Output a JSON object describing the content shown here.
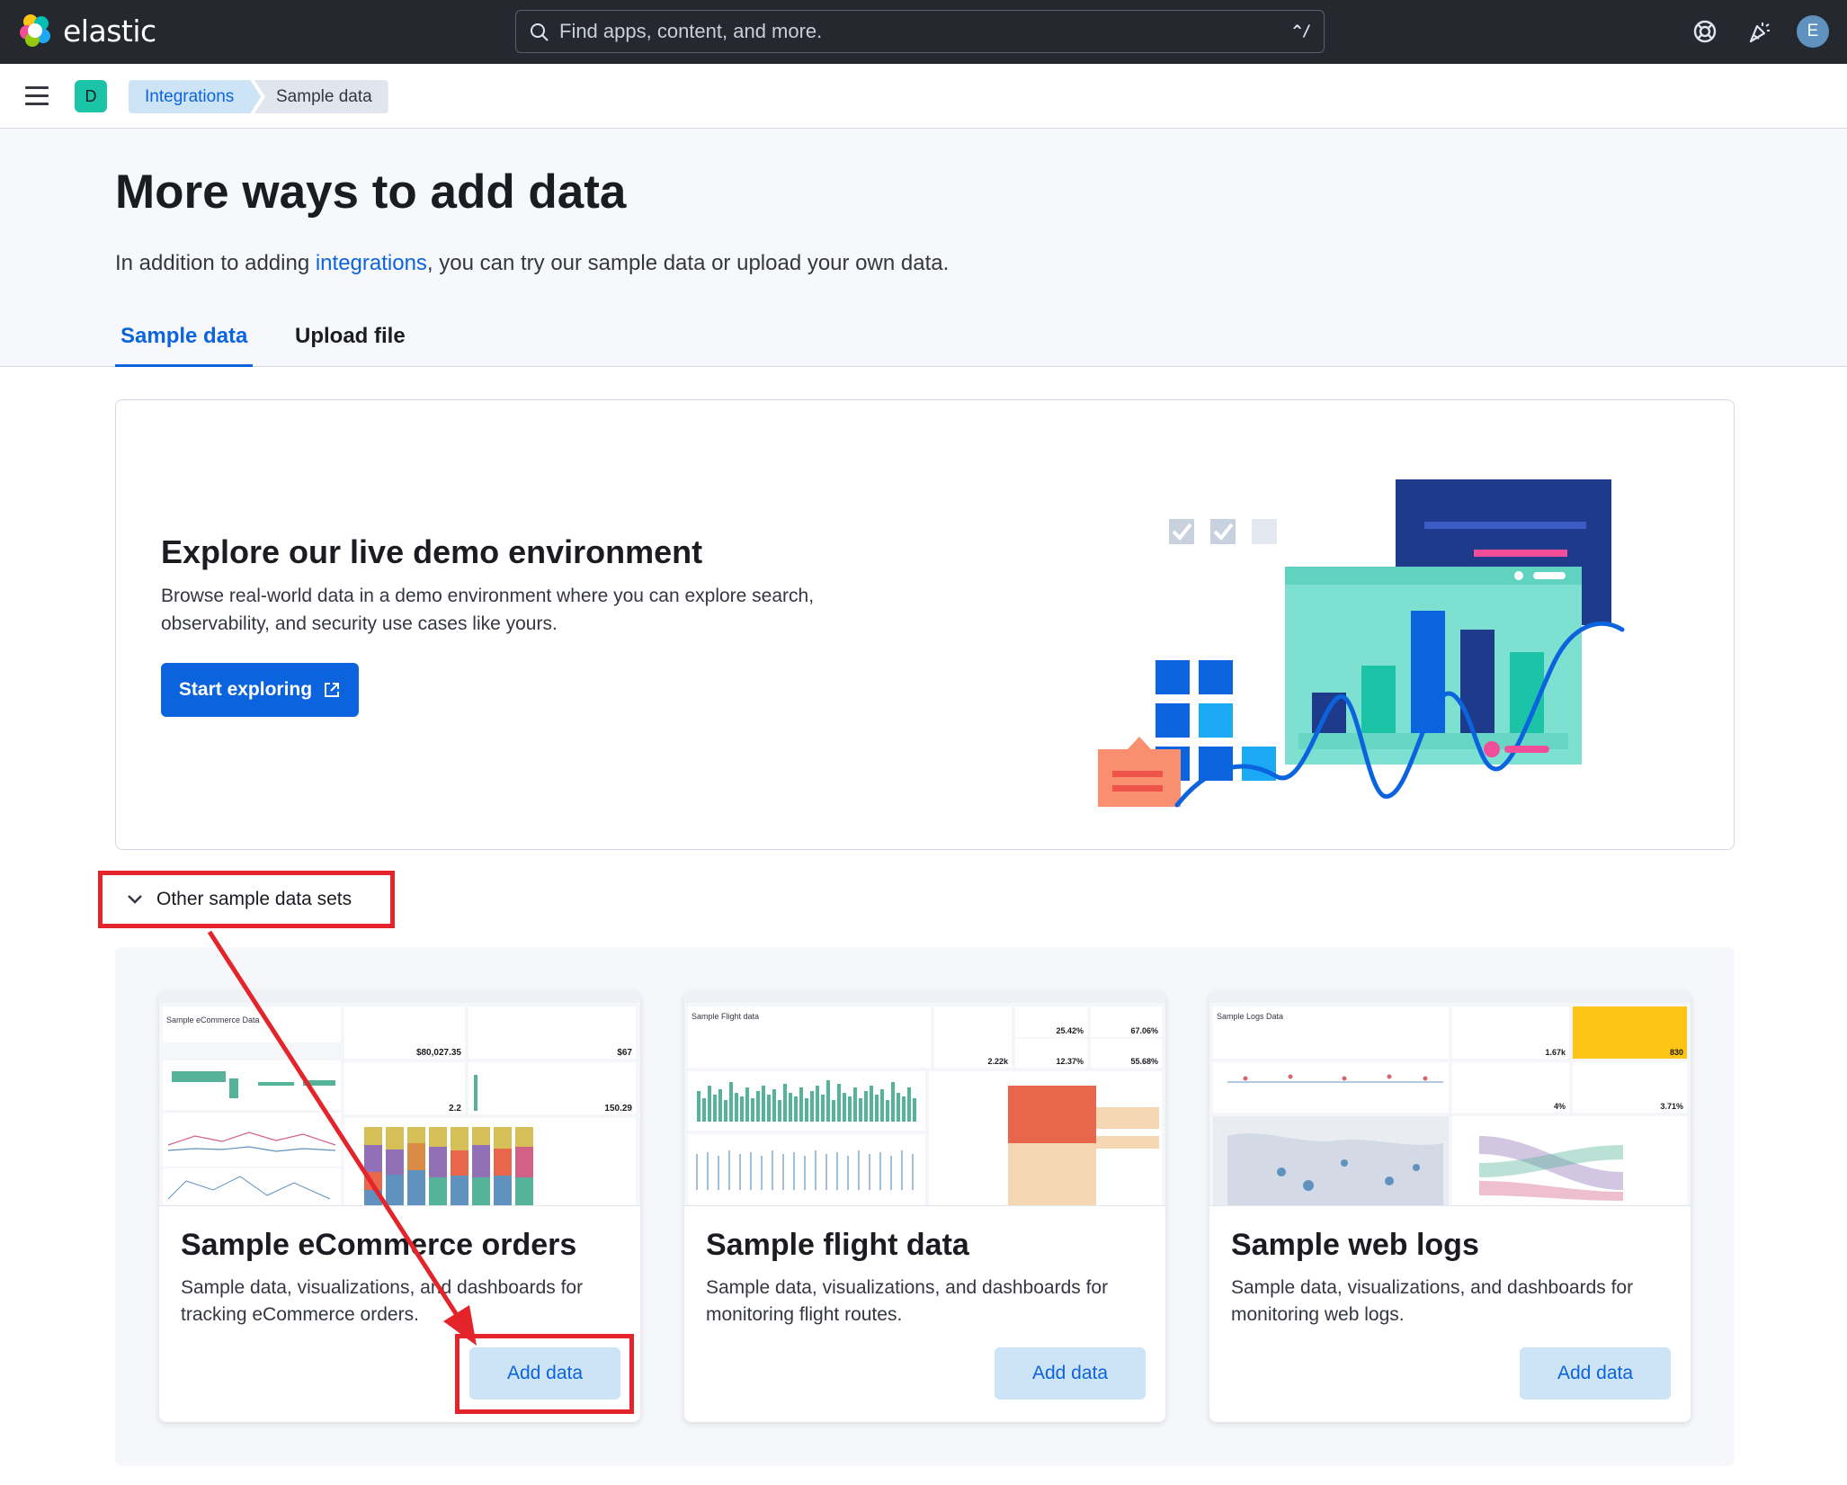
{
  "topbar": {
    "logo_text": "elastic",
    "search_placeholder": "Find apps, content, and more.",
    "search_shortcut": "^/",
    "user_initial": "E",
    "icons": [
      "help-icon",
      "news-feed-icon",
      "user-avatar"
    ]
  },
  "navbar": {
    "space_initial": "D",
    "breadcrumbs": [
      "Integrations",
      "Sample data"
    ]
  },
  "header": {
    "title": "More ways to add data",
    "desc_before": "In addition to adding ",
    "desc_link": "integrations",
    "desc_after": ", you can try our sample data or upload your own data.",
    "tabs": [
      {
        "label": "Sample data",
        "active": true
      },
      {
        "label": "Upload file",
        "active": false
      }
    ]
  },
  "demo": {
    "title": "Explore our live demo environment",
    "description": "Browse real-world data in a demo environment where you can explore search, observability, and security use cases like yours.",
    "button_label": "Start exploring"
  },
  "other_sets": {
    "toggle_label": "Other sample data sets"
  },
  "cards": [
    {
      "title": "Sample eCommerce orders",
      "description": "Sample data, visualizations, and dashboards for tracking eCommerce orders.",
      "button_label": "Add data",
      "thumb": {
        "heading": "Sample eCommerce Data",
        "value_revenue": "$80,027.35",
        "value_median": "$67",
        "value_items": "2.2",
        "value_trans": "150.29"
      }
    },
    {
      "title": "Sample flight data",
      "description": "Sample data, visualizations, and dashboards for monitoring flight routes.",
      "button_label": "Add data",
      "thumb": {
        "heading": "Sample Flight data",
        "value_delayed": "25.42%",
        "value_delayed_week": "67.06%",
        "value_cancelled": "12.37%",
        "value_cancelled_week": "55.68%",
        "value_total": "2.22k"
      }
    },
    {
      "title": "Sample web logs",
      "description": "Sample data, visualizations, and dashboards for monitoring web logs.",
      "button_label": "Add data",
      "thumb": {
        "heading": "Sample Logs Data",
        "value_visits": "1.67k",
        "value_unique": "830",
        "value_404": "4%",
        "value_503": "3.71%"
      }
    }
  ],
  "colors": {
    "accent": "#0b64dd",
    "annotation_red": "#e3242b",
    "topbar": "#25282f"
  }
}
